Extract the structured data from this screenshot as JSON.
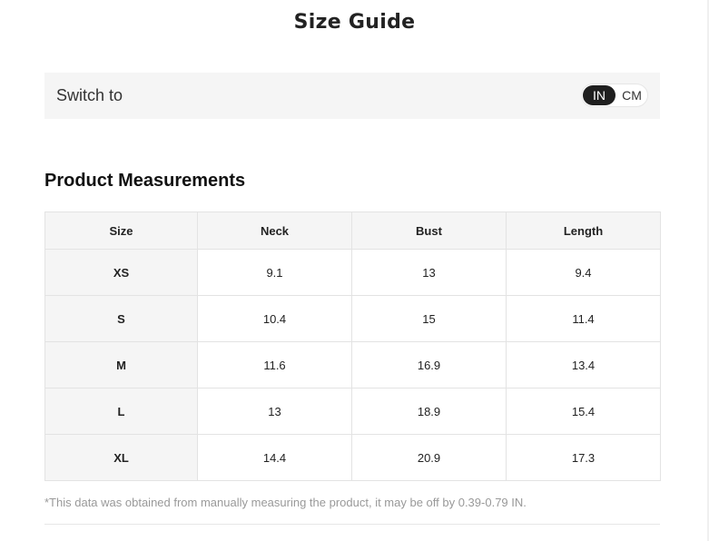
{
  "header": {
    "title": "Size Guide"
  },
  "unit_switch": {
    "label": "Switch to",
    "options": [
      "IN",
      "CM"
    ],
    "selected": "IN"
  },
  "measurements": {
    "title": "Product Measurements",
    "columns": [
      "Size",
      "Neck",
      "Bust",
      "Length"
    ],
    "rows": [
      [
        "XS",
        "9.1",
        "13",
        "9.4"
      ],
      [
        "S",
        "10.4",
        "15",
        "11.4"
      ],
      [
        "M",
        "11.6",
        "16.9",
        "13.4"
      ],
      [
        "L",
        "13",
        "18.9",
        "15.4"
      ],
      [
        "XL",
        "14.4",
        "20.9",
        "17.3"
      ]
    ],
    "note": "*This data was obtained from manually measuring the product, it may be off by 0.39-0.79 IN."
  },
  "colors": {
    "selected_toggle_bg": "#1f1f1f",
    "panel_bg": "#f5f5f5",
    "note_text": "#999999"
  }
}
